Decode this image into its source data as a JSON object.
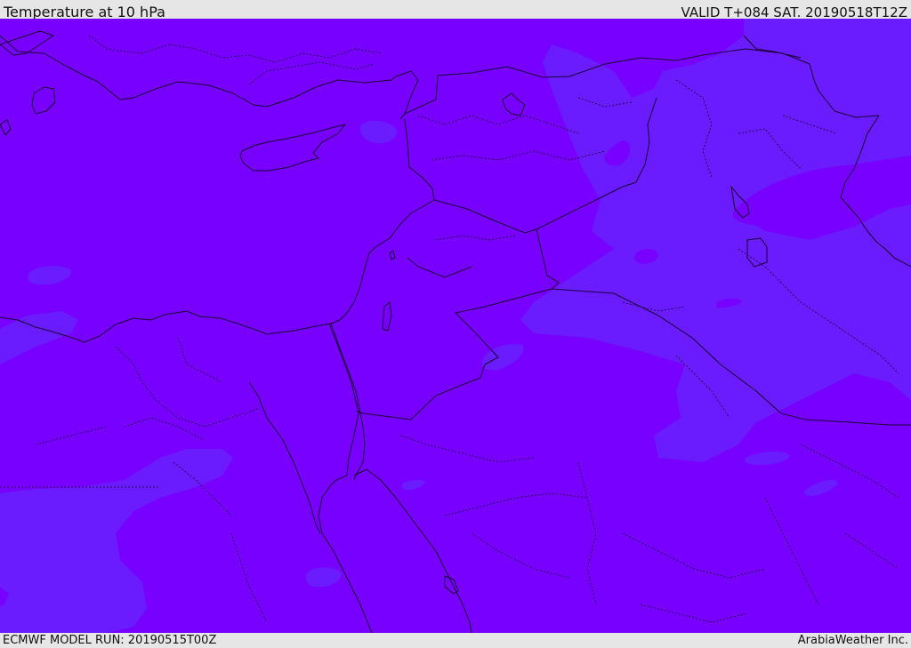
{
  "header": {
    "title": "Temperature at 10 hPa",
    "valid": "VALID T+084 SAT. 20190518T12Z"
  },
  "footer": {
    "model_run": "ECMWF MODEL RUN: 20190515T00Z",
    "credit": "ArabiaWeather Inc."
  },
  "colors": {
    "field_base": "#7800ff",
    "field_cool": "#6a1cff",
    "coastline": "#1a0033",
    "border": "#1a0033"
  }
}
